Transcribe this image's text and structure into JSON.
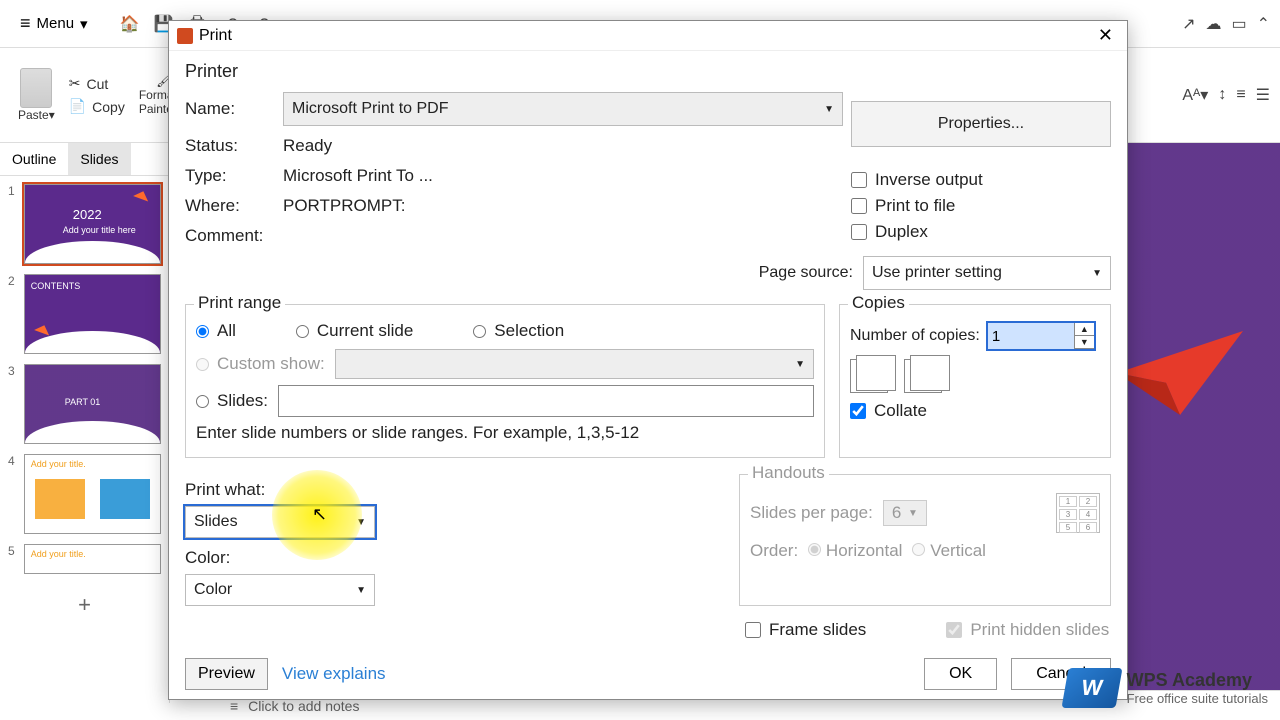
{
  "menu": {
    "label": "Menu"
  },
  "ribbon": {
    "paste": "Paste",
    "cut": "Cut",
    "copy": "Copy",
    "format_painter": "Format Painter"
  },
  "side_tabs": {
    "outline": "Outline",
    "slides": "Slides"
  },
  "thumbs": [
    {
      "num": "1",
      "title": "2022",
      "sub": "Add your title here"
    },
    {
      "num": "2",
      "title": "CONTENTS"
    },
    {
      "num": "3",
      "title": "PART 01"
    },
    {
      "num": "4",
      "title": "Add your title."
    },
    {
      "num": "5",
      "title": "Add your title."
    }
  ],
  "notes": {
    "placeholder": "Click to add notes"
  },
  "dialog": {
    "title": "Print",
    "printer": {
      "section": "Printer",
      "name_label": "Name:",
      "name_value": "Microsoft Print to PDF",
      "properties": "Properties...",
      "status_label": "Status:",
      "status_value": "Ready",
      "type_label": "Type:",
      "type_value": "Microsoft Print To ...",
      "where_label": "Where:",
      "where_value": "PORTPROMPT:",
      "comment_label": "Comment:",
      "inverse": "Inverse output",
      "print_to_file": "Print to file",
      "duplex": "Duplex"
    },
    "page_source": {
      "label": "Page source:",
      "value": "Use printer setting"
    },
    "range": {
      "legend": "Print range",
      "all": "All",
      "current": "Current slide",
      "selection": "Selection",
      "custom_show": "Custom show:",
      "slides": "Slides:",
      "hint": "Enter slide numbers or slide ranges. For example, 1,3,5-12"
    },
    "copies": {
      "legend": "Copies",
      "num_label": "Number of copies:",
      "value": "1",
      "collate": "Collate"
    },
    "print_what": {
      "label": "Print what:",
      "value": "Slides"
    },
    "color": {
      "label": "Color:",
      "value": "Color"
    },
    "handouts": {
      "legend": "Handouts",
      "spp": "Slides per page:",
      "spp_value": "6",
      "order": "Order:",
      "horizontal": "Horizontal",
      "vertical": "Vertical"
    },
    "frame_slides": "Frame slides",
    "print_hidden": "Print hidden slides",
    "preview": "Preview",
    "view_explains": "View explains",
    "ok": "OK",
    "cancel": "Cancel"
  },
  "watermark": {
    "brand": "WPS Academy",
    "sub": "Free office suite tutorials"
  }
}
